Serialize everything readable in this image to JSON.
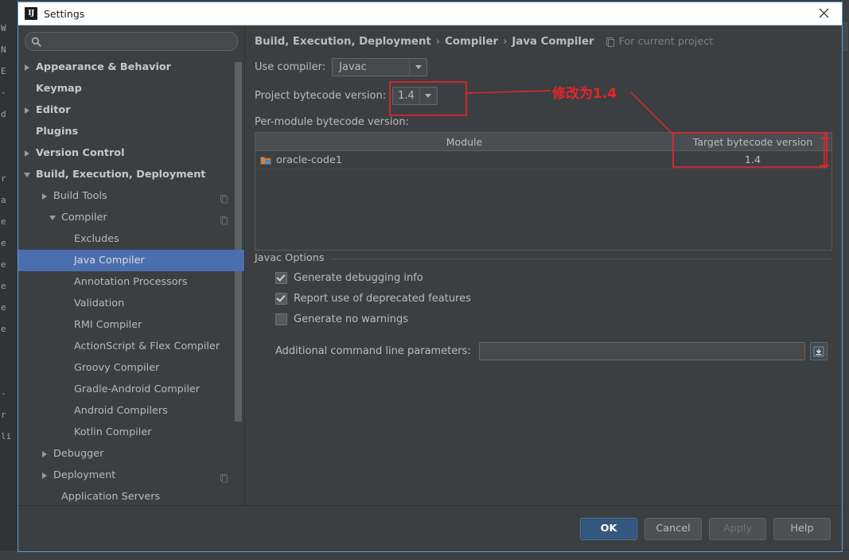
{
  "window": {
    "title": "Settings",
    "app_icon": "IJ",
    "close_icon": "close-icon"
  },
  "background": {
    "left_glyphs": "W\nN\nE\n-\nd\n\n\nr\na\ne\ne\ne\ne\ne\ne\n\n\n-\nr\nli",
    "status_text": ""
  },
  "search": {
    "value": "",
    "placeholder": "",
    "icon": "search-icon"
  },
  "sidebar": {
    "items": [
      {
        "label": "Appearance & Behavior",
        "indent": 0,
        "arrow": "right",
        "bold": true,
        "selected": false,
        "badge": false
      },
      {
        "label": "Keymap",
        "indent": 0,
        "arrow": "blank",
        "bold": true,
        "selected": false,
        "badge": false
      },
      {
        "label": "Editor",
        "indent": 0,
        "arrow": "right",
        "bold": true,
        "selected": false,
        "badge": false
      },
      {
        "label": "Plugins",
        "indent": 0,
        "arrow": "blank",
        "bold": true,
        "selected": false,
        "badge": false
      },
      {
        "label": "Version Control",
        "indent": 0,
        "arrow": "right",
        "bold": true,
        "selected": false,
        "badge": false
      },
      {
        "label": "Build, Execution, Deployment",
        "indent": 0,
        "arrow": "down",
        "bold": true,
        "selected": false,
        "badge": false
      },
      {
        "label": "Build Tools",
        "indent": 1,
        "arrow": "right",
        "bold": false,
        "selected": false,
        "badge": true
      },
      {
        "label": "Compiler",
        "indent": 2,
        "arrow": "down",
        "bold": false,
        "selected": false,
        "badge": true
      },
      {
        "label": "Excludes",
        "indent": 3,
        "arrow": "blank",
        "bold": false,
        "selected": false,
        "badge": false
      },
      {
        "label": "Java Compiler",
        "indent": 3,
        "arrow": "blank",
        "bold": false,
        "selected": true,
        "badge": false
      },
      {
        "label": "Annotation Processors",
        "indent": 3,
        "arrow": "blank",
        "bold": false,
        "selected": false,
        "badge": false
      },
      {
        "label": "Validation",
        "indent": 3,
        "arrow": "blank",
        "bold": false,
        "selected": false,
        "badge": false
      },
      {
        "label": "RMI Compiler",
        "indent": 3,
        "arrow": "blank",
        "bold": false,
        "selected": false,
        "badge": false
      },
      {
        "label": "ActionScript & Flex Compiler",
        "indent": 3,
        "arrow": "blank",
        "bold": false,
        "selected": false,
        "badge": false
      },
      {
        "label": "Groovy Compiler",
        "indent": 3,
        "arrow": "blank",
        "bold": false,
        "selected": false,
        "badge": false
      },
      {
        "label": "Gradle-Android Compiler",
        "indent": 3,
        "arrow": "blank",
        "bold": false,
        "selected": false,
        "badge": false
      },
      {
        "label": "Android Compilers",
        "indent": 3,
        "arrow": "blank",
        "bold": false,
        "selected": false,
        "badge": false
      },
      {
        "label": "Kotlin Compiler",
        "indent": 3,
        "arrow": "blank",
        "bold": false,
        "selected": false,
        "badge": false
      },
      {
        "label": "Debugger",
        "indent": 1,
        "arrow": "right",
        "bold": false,
        "selected": false,
        "badge": false
      },
      {
        "label": "Deployment",
        "indent": 1,
        "arrow": "right",
        "bold": false,
        "selected": false,
        "badge": true
      },
      {
        "label": "Application Servers",
        "indent": 2,
        "arrow": "blank",
        "bold": false,
        "selected": false,
        "badge": false
      }
    ]
  },
  "content": {
    "breadcrumb": {
      "parts": [
        "Build, Execution, Deployment",
        "Compiler",
        "Java Compiler"
      ],
      "separator": "›",
      "scope_label": "For current project",
      "scope_icon": "copy-scope-icon"
    },
    "use_compiler": {
      "label": "Use compiler:",
      "value": "Javac"
    },
    "project_bytecode": {
      "label": "Project bytecode version:",
      "value": "1.4"
    },
    "per_module_label": "Per-module bytecode version:",
    "table": {
      "columns": [
        "Module",
        "Target bytecode version"
      ],
      "rows": [
        {
          "module": "oracle-code1",
          "target": "1.4",
          "icon": "module-folder-icon"
        }
      ]
    },
    "javac_options": {
      "title": "Javac Options",
      "checkboxes": [
        {
          "label": "Generate debugging info",
          "checked": true
        },
        {
          "label": "Report use of deprecated features",
          "checked": true
        },
        {
          "label": "Generate no warnings",
          "checked": false
        }
      ],
      "additional_params": {
        "label": "Additional command line parameters:",
        "value": "",
        "placeholder": "",
        "button_icon": "expand-editor-icon"
      }
    }
  },
  "footer": {
    "buttons": [
      {
        "label": "OK",
        "style": "primary",
        "enabled": true
      },
      {
        "label": "Cancel",
        "style": "normal",
        "enabled": true
      },
      {
        "label": "Apply",
        "style": "disabled",
        "enabled": false
      },
      {
        "label": "Help",
        "style": "normal",
        "enabled": true
      }
    ]
  },
  "annotation": {
    "text": "修改为1.4",
    "color": "#e8252c"
  }
}
